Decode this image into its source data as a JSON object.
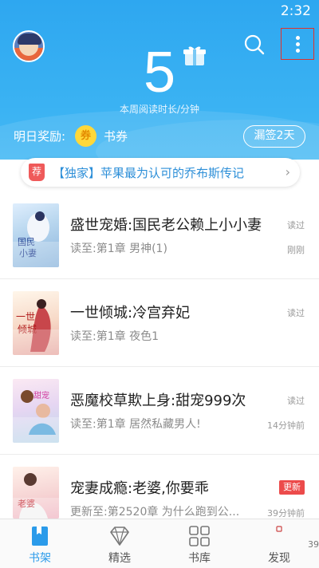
{
  "status_bar": {
    "time": "2:32"
  },
  "header": {
    "weekly_minutes": "5",
    "weekly_label": "本周阅读时长/分钟",
    "reward_label": "明日奖励:",
    "coupon_icon_text": "券",
    "coupon_label": "书券",
    "missed_sign_button": "漏签2天",
    "colors": {
      "background": "#2ea7f0",
      "accent_red": "#e0322b"
    }
  },
  "banner": {
    "badge": "荐",
    "text": "【独家】苹果最为认可的乔布斯传记"
  },
  "books": [
    {
      "title": "盛世宠婚:国民老公赖上小小妻",
      "progress": "读至:第1章 男神(1)",
      "status": "读过",
      "time": "刚刚",
      "cover_icon": "book-cover-shengshi"
    },
    {
      "title": "一世倾城:冷宫弃妃",
      "progress": "读至:第1章 夜色1",
      "status": "读过",
      "time": "",
      "cover_icon": "book-cover-yishi"
    },
    {
      "title": "恶魔校草欺上身:甜宠999次",
      "progress": "读至:第1章 居然私藏男人!",
      "status": "读过",
      "time": "14分钟前",
      "cover_icon": "book-cover-emo"
    },
    {
      "title": "宠妻成瘾:老婆,你要乖",
      "progress": "更新至:第2520章 为什么跑到公...",
      "status": "更新",
      "time": "39分钟前",
      "cover_icon": "book-cover-chongqi"
    }
  ],
  "tabs": [
    {
      "label": "书架",
      "icon": "bookshelf-icon",
      "active": true
    },
    {
      "label": "精选",
      "icon": "diamond-icon",
      "active": false
    },
    {
      "label": "书库",
      "icon": "grid-icon",
      "active": false
    },
    {
      "label": "发现",
      "icon": "discover-icon",
      "active": false
    }
  ],
  "side_number": "39"
}
